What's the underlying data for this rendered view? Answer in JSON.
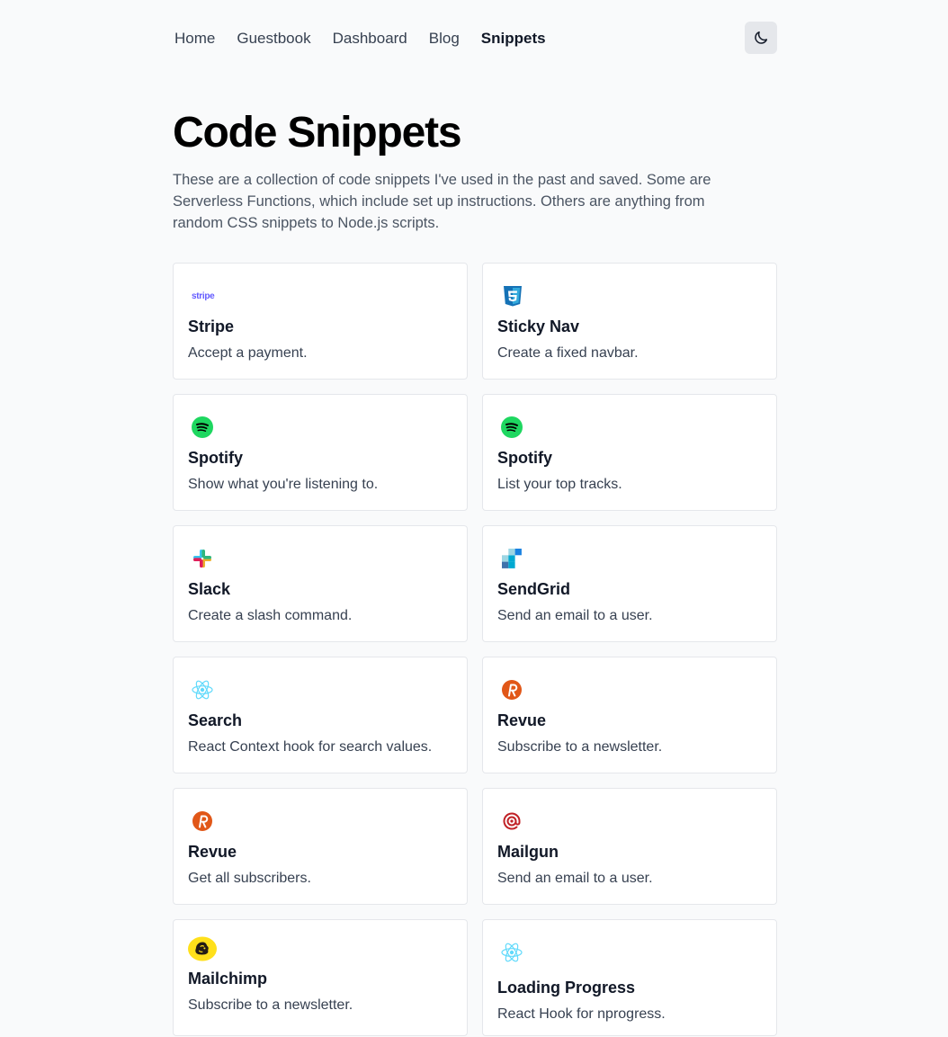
{
  "nav": {
    "links": [
      {
        "label": "Home"
      },
      {
        "label": "Guestbook"
      },
      {
        "label": "Dashboard"
      },
      {
        "label": "Blog"
      },
      {
        "label": "Snippets"
      }
    ],
    "active": "Snippets",
    "theme_toggle_icon": "moon-icon"
  },
  "page": {
    "title": "Code Snippets",
    "intro": "These are a collection of code snippets I've used in the past and saved. Some are Serverless Functions, which include set up instructions. Others are anything from random CSS snippets to Node.js scripts."
  },
  "snippets": [
    {
      "title": "Stripe",
      "description": "Accept a payment.",
      "logo": "stripe-logo",
      "logo_text": "stripe"
    },
    {
      "title": "Sticky Nav",
      "description": "Create a fixed navbar.",
      "logo": "css3-logo"
    },
    {
      "title": "Spotify",
      "description": "Show what you're listening to.",
      "logo": "spotify-logo"
    },
    {
      "title": "Spotify",
      "description": "List your top tracks.",
      "logo": "spotify-logo"
    },
    {
      "title": "Slack",
      "description": "Create a slash command.",
      "logo": "slack-logo"
    },
    {
      "title": "SendGrid",
      "description": "Send an email to a user.",
      "logo": "sendgrid-logo"
    },
    {
      "title": "Search",
      "description": "React Context hook for search values.",
      "logo": "react-logo"
    },
    {
      "title": "Revue",
      "description": "Subscribe to a newsletter.",
      "logo": "revue-logo"
    },
    {
      "title": "Revue",
      "description": "Get all subscribers.",
      "logo": "revue-logo"
    },
    {
      "title": "Mailgun",
      "description": "Send an email to a user.",
      "logo": "mailgun-logo"
    },
    {
      "title": "Mailchimp",
      "description": "Subscribe to a newsletter.",
      "logo": "mailchimp-logo"
    },
    {
      "title": "Loading Progress",
      "description": "React Hook for nprogress.",
      "logo": "react-logo"
    }
  ],
  "colors": {
    "background": "#f9fafb",
    "card_border": "#e5e7eb",
    "stripe": "#635bff",
    "css3": "#1572b6",
    "spotify": "#1ed760",
    "revue": "#e15718",
    "mailgun": "#c02126",
    "mailchimp": "#ffe01b",
    "react": "#61dafb",
    "sendgrid": "#1a82e2"
  }
}
